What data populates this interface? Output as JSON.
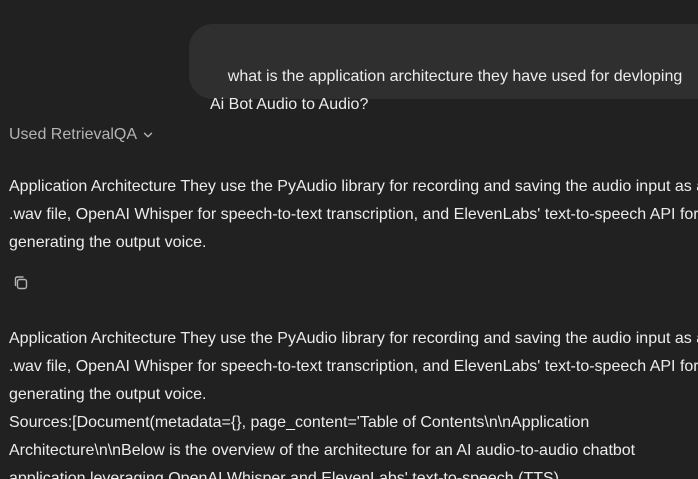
{
  "user_message": {
    "text": "what is the application architecture they have used for devloping Ai Bot Audio to Audio?"
  },
  "tool": {
    "label": "Used RetrievalQA"
  },
  "response1": {
    "text": "Application Architecture They use the PyAudio library for recording and saving the audio input as a .wav file, OpenAI Whisper for speech-to-text transcription, and ElevenLabs' text-to-speech API for generating the output voice."
  },
  "response2": {
    "text": "Application Architecture They use the PyAudio library for recording and saving the audio input as a .wav file, OpenAI Whisper for speech-to-text transcription, and ElevenLabs' text-to-speech API for generating the output voice.",
    "sources": "Sources:[Document(metadata={}, page_content='Table of Contents\\n\\nApplication Architecture\\n\\nBelow is the overview of the architecture for an AI audio-to-audio chatbot application leveraging OpenAI Whisper and ElevenLabs' text-to-speech (TTS)"
  },
  "icons": {
    "tool_toggle": "chevron-down-icon",
    "copy": "copy-icon"
  },
  "colors": {
    "background": "#212121",
    "bubble": "#2f2f2f",
    "text": "#ececec",
    "muted": "#b4b4b4"
  }
}
